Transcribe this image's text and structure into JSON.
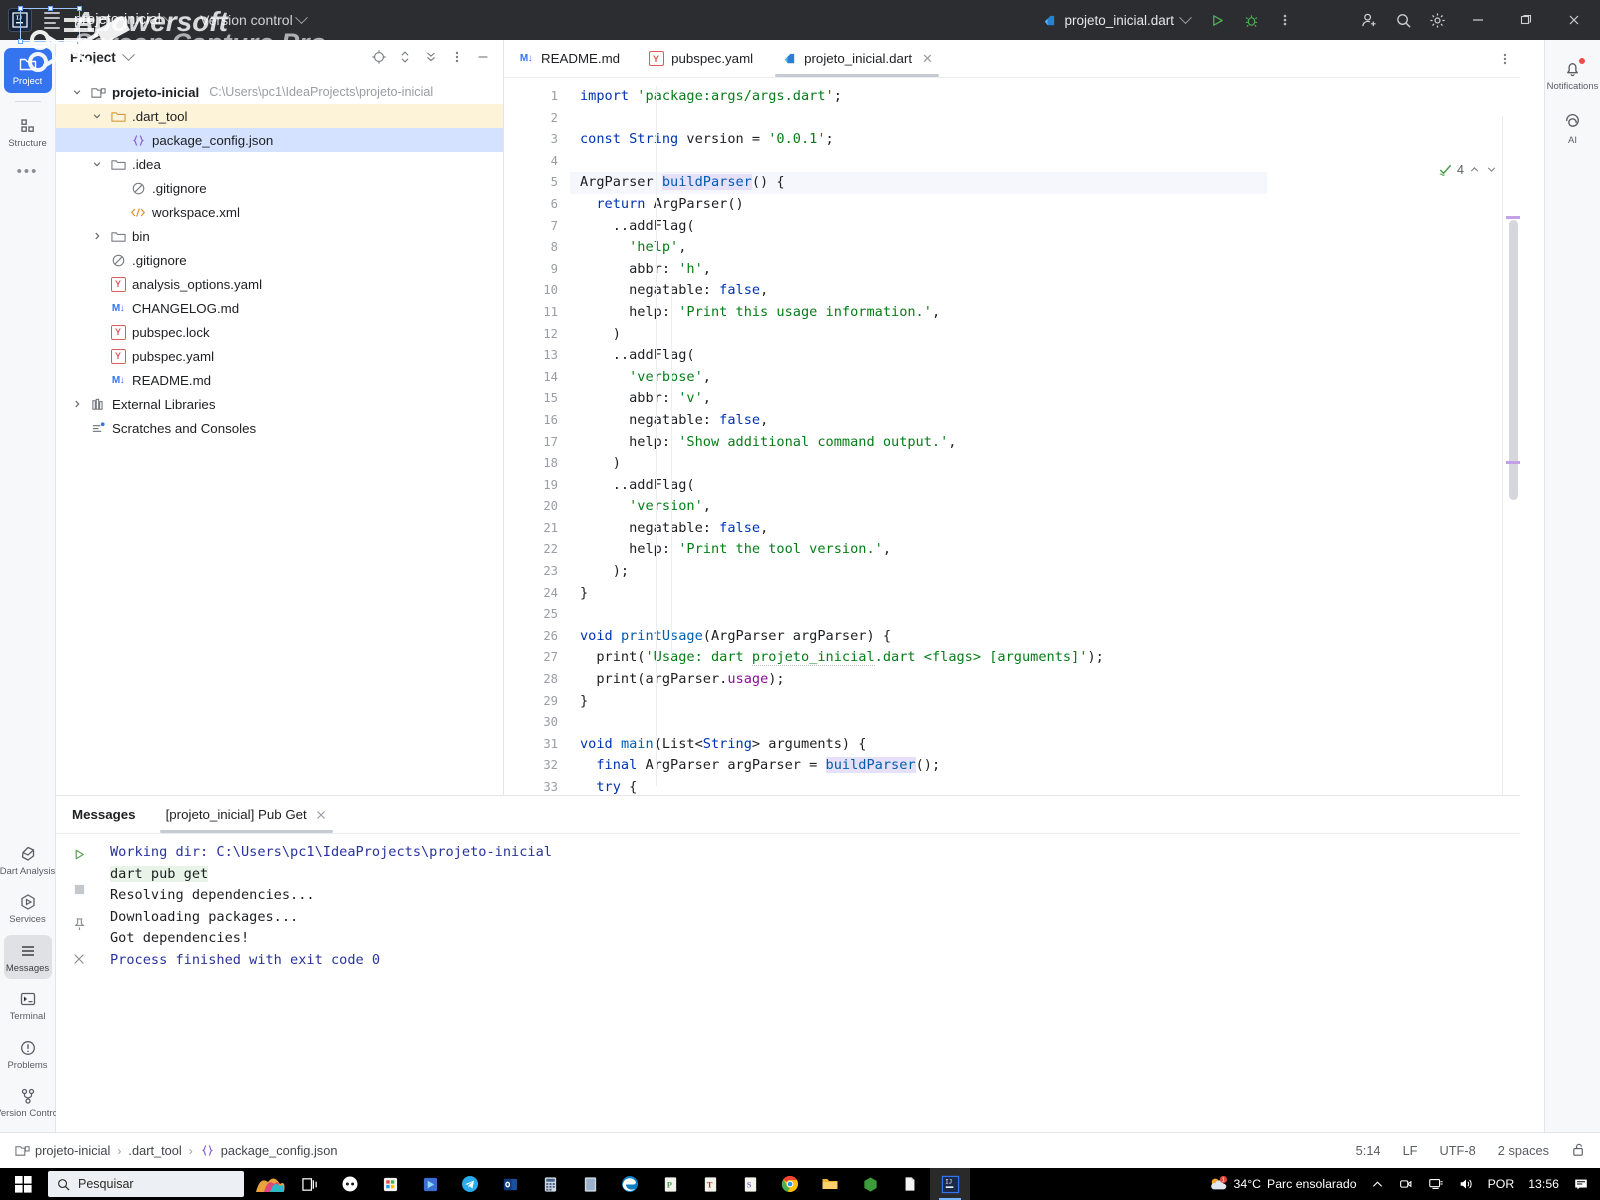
{
  "titlebar": {
    "logo_text": "IJ",
    "project_name": "projeto-inicial",
    "version_control": "Version control",
    "run_config": "projeto_inicial.dart",
    "icons": [
      "run-icon",
      "debug-icon",
      "more-vertical-icon",
      "add-user-icon",
      "search-icon",
      "settings-icon"
    ],
    "window": {
      "minimize": "–",
      "maximize": "❐",
      "close": "✕"
    }
  },
  "watermark": {
    "line1": "Apowersoft",
    "line2": "Screen Capture Pro"
  },
  "left_rail": {
    "top": [
      {
        "label": "Project",
        "icon": "folder-icon",
        "active": true
      },
      {
        "label": "Structure",
        "icon": "structure-icon",
        "active": false
      }
    ],
    "more": "•••",
    "bottom": [
      {
        "label": "Dart Analysis",
        "icon": "dart-analysis-icon",
        "active": false
      },
      {
        "label": "Services",
        "icon": "services-icon",
        "active": false
      },
      {
        "label": "Messages",
        "icon": "messages-icon",
        "active": true
      },
      {
        "label": "Terminal",
        "icon": "terminal-icon",
        "active": false
      },
      {
        "label": "Problems",
        "icon": "problems-icon",
        "active": false
      },
      {
        "label": "Version Control",
        "icon": "version-control-icon",
        "active": false
      }
    ]
  },
  "right_rail": [
    {
      "label": "Notifications",
      "icon": "bell-icon",
      "badge": true
    },
    {
      "label": "AI",
      "icon": "ai-icon",
      "badge": false
    }
  ],
  "project_panel": {
    "title": "Project",
    "tools": [
      "locate-icon",
      "expand-collapse-icon",
      "collapse-all-icon",
      "more-options-icon",
      "minimize-icon"
    ],
    "tree": [
      {
        "indent": 0,
        "arrow": "down",
        "icon": "module-icon",
        "name": "projeto-inicial",
        "bold": true,
        "path": "C:\\Users\\pc1\\IdeaProjects\\projeto-inicial",
        "state": "none"
      },
      {
        "indent": 1,
        "arrow": "down",
        "icon": "folder-orange",
        "name": ".dart_tool",
        "bold": false,
        "path": "",
        "state": "hl"
      },
      {
        "indent": 2,
        "arrow": "none",
        "icon": "json-icon",
        "name": "package_config.json",
        "bold": false,
        "path": "",
        "state": "sel"
      },
      {
        "indent": 1,
        "arrow": "down",
        "icon": "folder-gray",
        "name": ".idea",
        "bold": false,
        "path": "",
        "state": "none"
      },
      {
        "indent": 2,
        "arrow": "none",
        "icon": "gitignore-icon",
        "name": ".gitignore",
        "bold": false,
        "path": "",
        "state": "none"
      },
      {
        "indent": 2,
        "arrow": "none",
        "icon": "xml-icon",
        "name": "workspace.xml",
        "bold": false,
        "path": "",
        "state": "none"
      },
      {
        "indent": 1,
        "arrow": "right",
        "icon": "folder-gray",
        "name": "bin",
        "bold": false,
        "path": "",
        "state": "none"
      },
      {
        "indent": 1,
        "arrow": "none",
        "icon": "gitignore-icon",
        "name": ".gitignore",
        "bold": false,
        "path": "",
        "state": "none"
      },
      {
        "indent": 1,
        "arrow": "none",
        "icon": "yaml-icon",
        "name": "analysis_options.yaml",
        "bold": false,
        "path": "",
        "state": "none"
      },
      {
        "indent": 1,
        "arrow": "none",
        "icon": "md-icon",
        "name": "CHANGELOG.md",
        "bold": false,
        "path": "",
        "state": "none"
      },
      {
        "indent": 1,
        "arrow": "none",
        "icon": "yaml-icon",
        "name": "pubspec.lock",
        "bold": false,
        "path": "",
        "state": "none"
      },
      {
        "indent": 1,
        "arrow": "none",
        "icon": "yaml-icon",
        "name": "pubspec.yaml",
        "bold": false,
        "path": "",
        "state": "none"
      },
      {
        "indent": 1,
        "arrow": "none",
        "icon": "md-icon",
        "name": "README.md",
        "bold": false,
        "path": "",
        "state": "none"
      },
      {
        "indent": 0,
        "arrow": "right",
        "icon": "library-icon",
        "name": "External Libraries",
        "bold": false,
        "path": "",
        "state": "none"
      },
      {
        "indent": 0,
        "arrow": "none",
        "icon": "scratches-icon",
        "name": "Scratches and Consoles",
        "bold": false,
        "path": "",
        "state": "none"
      }
    ]
  },
  "editor": {
    "tabs": [
      {
        "label": "README.md",
        "icon": "md-icon",
        "active": false,
        "closable": false
      },
      {
        "label": "pubspec.yaml",
        "icon": "yaml-icon",
        "active": false,
        "closable": false
      },
      {
        "label": "projeto_inicial.dart",
        "icon": "dart-icon",
        "active": true,
        "closable": true
      }
    ],
    "inspection_count": "4",
    "current_line": 5,
    "lines": [
      {
        "n": 1,
        "text": "import 'package:args/args.dart';"
      },
      {
        "n": 2,
        "text": ""
      },
      {
        "n": 3,
        "text": "const String version = '0.0.1';"
      },
      {
        "n": 4,
        "text": ""
      },
      {
        "n": 5,
        "text": "ArgParser buildParser() {"
      },
      {
        "n": 6,
        "text": "  return ArgParser()"
      },
      {
        "n": 7,
        "text": "    ..addFlag("
      },
      {
        "n": 8,
        "text": "      'help',"
      },
      {
        "n": 9,
        "text": "      abbr: 'h',"
      },
      {
        "n": 10,
        "text": "      negatable: false,"
      },
      {
        "n": 11,
        "text": "      help: 'Print this usage information.',"
      },
      {
        "n": 12,
        "text": "    )"
      },
      {
        "n": 13,
        "text": "    ..addFlag("
      },
      {
        "n": 14,
        "text": "      'verbose',"
      },
      {
        "n": 15,
        "text": "      abbr: 'v',"
      },
      {
        "n": 16,
        "text": "      negatable: false,"
      },
      {
        "n": 17,
        "text": "      help: 'Show additional command output.',"
      },
      {
        "n": 18,
        "text": "    )"
      },
      {
        "n": 19,
        "text": "    ..addFlag("
      },
      {
        "n": 20,
        "text": "      'version',"
      },
      {
        "n": 21,
        "text": "      negatable: false,"
      },
      {
        "n": 22,
        "text": "      help: 'Print the tool version.',"
      },
      {
        "n": 23,
        "text": "    );"
      },
      {
        "n": 24,
        "text": "}"
      },
      {
        "n": 25,
        "text": ""
      },
      {
        "n": 26,
        "text": "void printUsage(ArgParser argParser) {"
      },
      {
        "n": 27,
        "text": "  print('Usage: dart projeto_inicial.dart <flags> [arguments]');"
      },
      {
        "n": 28,
        "text": "  print(argParser.usage);"
      },
      {
        "n": 29,
        "text": "}"
      },
      {
        "n": 30,
        "text": ""
      },
      {
        "n": 31,
        "text": "void main(List<String> arguments) {"
      },
      {
        "n": 32,
        "text": "  final ArgParser argParser = buildParser();"
      },
      {
        "n": 33,
        "text": "  try {"
      }
    ]
  },
  "messages_panel": {
    "title": "Messages",
    "tab": "[projeto_inicial] Pub Get",
    "side_icons": [
      "rerun-icon",
      "stop-icon",
      "pin-icon",
      "close-icon"
    ],
    "console": [
      {
        "text": "Working dir: C:\\Users\\pc1\\IdeaProjects\\projeto-inicial",
        "style": "blue"
      },
      {
        "text": "dart pub get",
        "style": "cmd"
      },
      {
        "text": "Resolving dependencies...",
        "style": "plain"
      },
      {
        "text": "Downloading packages...",
        "style": "plain"
      },
      {
        "text": "Got dependencies!",
        "style": "plain"
      },
      {
        "text": "Process finished with exit code 0",
        "style": "blue"
      }
    ]
  },
  "status_bar": {
    "breadcrumbs": [
      {
        "label": "projeto-inicial",
        "icon": "module-icon"
      },
      {
        "label": ".dart_tool",
        "icon": ""
      },
      {
        "label": "package_config.json",
        "icon": "json-icon"
      }
    ],
    "caret": "5:14",
    "line_sep": "LF",
    "encoding": "UTF-8",
    "indent": "2 spaces",
    "lock_icon": "unlocked-icon"
  },
  "taskbar": {
    "search_placeholder": "Pesquisar",
    "apps": [
      "task-view-icon",
      "copilot-icon",
      "store-icon",
      "clipchamp-icon",
      "telegram-icon",
      "outlook-icon",
      "calculator-icon",
      "excel-icon",
      "edge-icon",
      "powerpoint-icon",
      "text-editor-icon",
      "onenote-icon",
      "chrome-icon",
      "explorer-icon",
      "nodejs-icon",
      "notepad-icon",
      "intellij-icon"
    ],
    "weather_temp": "34°C",
    "weather_desc": "Parc ensolarado",
    "language": "POR",
    "clock": "13:56",
    "tray_icons": [
      "chevron-up-icon",
      "camera-icon",
      "network-icon",
      "volume-icon",
      "notifications-icon"
    ]
  }
}
